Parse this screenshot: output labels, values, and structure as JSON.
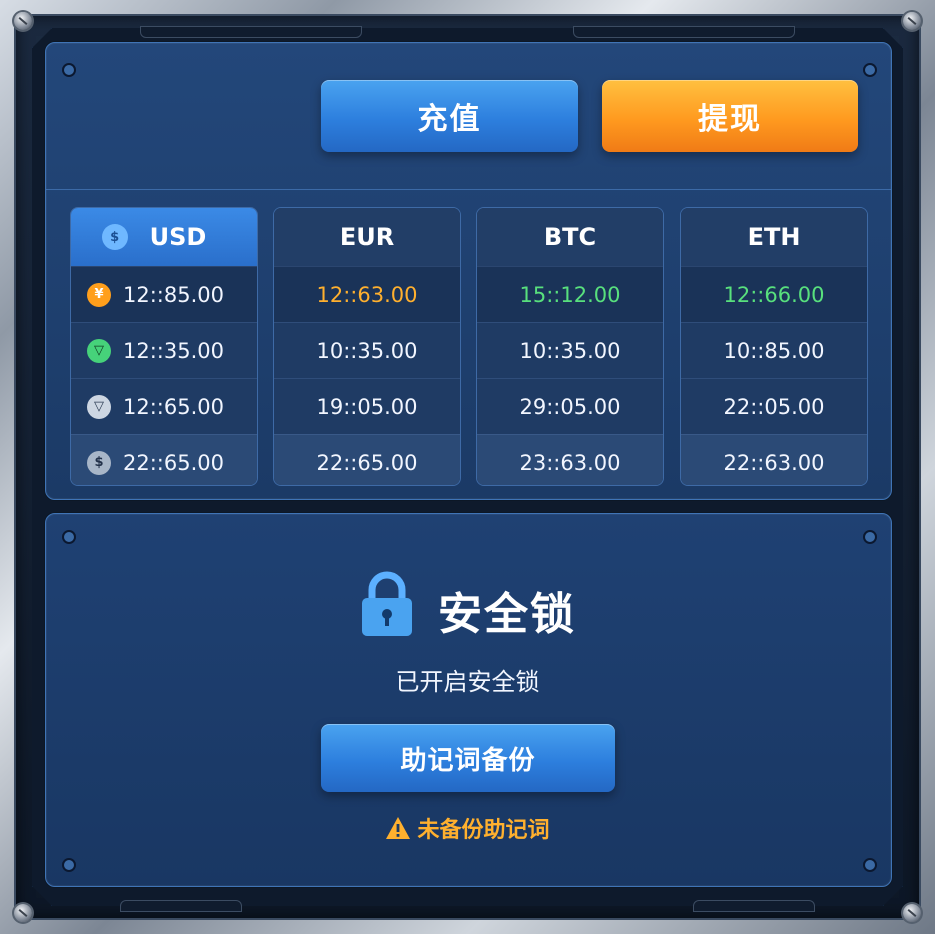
{
  "actions": {
    "deposit_label": "充值",
    "withdraw_label": "提现"
  },
  "currencies": [
    {
      "code": "USD",
      "active": true,
      "rows": [
        {
          "icon": "yen-coin-icon",
          "value": "12::85.00"
        },
        {
          "icon": "green-triangle-icon",
          "value": "12::35.00"
        },
        {
          "icon": "grey-triangle-icon",
          "value": "12::65.00"
        },
        {
          "icon": "dollar-coin-icon",
          "value": "22::65.00"
        }
      ]
    },
    {
      "code": "EUR",
      "active": false,
      "rows": [
        {
          "value": "12::63.00",
          "color": "#ffb02e"
        },
        {
          "value": "10::35.00"
        },
        {
          "value": "19::05.00"
        },
        {
          "value": "22::65.00"
        }
      ]
    },
    {
      "code": "BTC",
      "active": false,
      "rows": [
        {
          "value": "15::12.00",
          "color": "#58e07d"
        },
        {
          "value": "10::35.00"
        },
        {
          "value": "29::05.00"
        },
        {
          "value": "23::63.00"
        }
      ]
    },
    {
      "code": "ETH",
      "active": false,
      "rows": [
        {
          "value": "12::66.00",
          "color": "#58e07d"
        },
        {
          "value": "10::85.00"
        },
        {
          "value": "22::05.00"
        },
        {
          "value": "22::63.00"
        }
      ]
    }
  ],
  "security": {
    "title": "安全锁",
    "status": "已开启安全锁",
    "backup_label": "助记词备份",
    "warning": "未备份助记词",
    "lock_icon": "lock-icon",
    "warning_icon": "warning-icon"
  },
  "colors": {
    "accent_blue": "#2d7fde",
    "accent_orange": "#ff9a1f",
    "positive": "#58e07d",
    "warning": "#ffb02e"
  }
}
